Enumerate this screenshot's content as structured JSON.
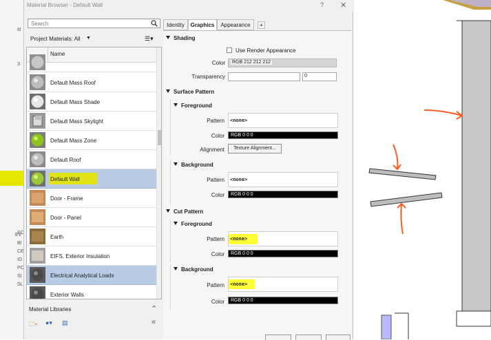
{
  "window": {
    "title": "Material Browser - Default Wall",
    "help": "?",
    "close": "✕"
  },
  "left_strip": {
    "letters": [
      "itl",
      "3",
      "SC",
      "BI",
      "CE",
      "ID",
      "PC",
      "SI",
      "SL",
      "EV"
    ]
  },
  "search": {
    "placeholder": "Search"
  },
  "project_materials": {
    "label": "Project Materials: All",
    "filter_icon": "filter-icon",
    "view_icon": "list-view-icon"
  },
  "material_list": {
    "header": "Name",
    "items": [
      {
        "label": "Default Mass Roof",
        "icon": "sphere-gray"
      },
      {
        "label": "Default Mass Shade",
        "icon": "sphere-light"
      },
      {
        "label": "Default Mass Skylight",
        "icon": "cube-glass"
      },
      {
        "label": "Default Mass Zone",
        "icon": "sphere-green"
      },
      {
        "label": "Default Roof",
        "icon": "sphere-gray"
      },
      {
        "label": "Default Wall",
        "icon": "sphere-green",
        "selected": true,
        "highlighted": true
      },
      {
        "label": "Door - Frame",
        "icon": "cube-wood"
      },
      {
        "label": "Door - Panel",
        "icon": "cube-wood"
      },
      {
        "label": "Earth",
        "icon": "cube-earth"
      },
      {
        "label": "EIFS, Exterior Insulation",
        "icon": "cube-stone"
      },
      {
        "label": "Electrical Analytical Loads",
        "icon": "sphere-dark",
        "selected": true
      },
      {
        "label": "Exterior Walls",
        "icon": "sphere-dark"
      }
    ]
  },
  "material_libraries": {
    "label": "Material Libraries"
  },
  "tabs": [
    {
      "label": "Identity",
      "active": false
    },
    {
      "label": "Graphics",
      "active": true
    },
    {
      "label": "Appearance",
      "active": false
    },
    {
      "label": "+",
      "active": false
    }
  ],
  "shading": {
    "title": "Shading",
    "use_render_appearance": "Use Render Appearance",
    "color_label": "Color",
    "color_value": "RGB 212 212 212",
    "transparency_label": "Transparency",
    "transparency_value": "0"
  },
  "surface_pattern": {
    "title": "Surface Pattern",
    "foreground": {
      "title": "Foreground",
      "pattern_label": "Pattern",
      "pattern_value": "<none>",
      "color_label": "Color",
      "color_value": "RGB 0 0 0",
      "alignment_label": "Alignment",
      "alignment_button": "Texture Alignment..."
    },
    "background": {
      "title": "Background",
      "pattern_label": "Pattern",
      "pattern_value": "<none>",
      "color_label": "Color",
      "color_value": "RGB 0 0 0"
    }
  },
  "cut_pattern": {
    "title": "Cut Pattern",
    "foreground": {
      "title": "Foreground",
      "pattern_label": "Pattern",
      "pattern_value": "<none>",
      "color_label": "Color",
      "color_value": "RGB 0 0 0"
    },
    "background": {
      "title": "Background",
      "pattern_label": "Pattern",
      "pattern_value": "<none>",
      "color_label": "Color",
      "color_value": "RGB 0 0 0"
    }
  },
  "colors": {
    "selection": "#b8cde5",
    "highlight": "#e6e600",
    "arrow": "#ff5a1f",
    "wall": "#c8c8c8"
  }
}
